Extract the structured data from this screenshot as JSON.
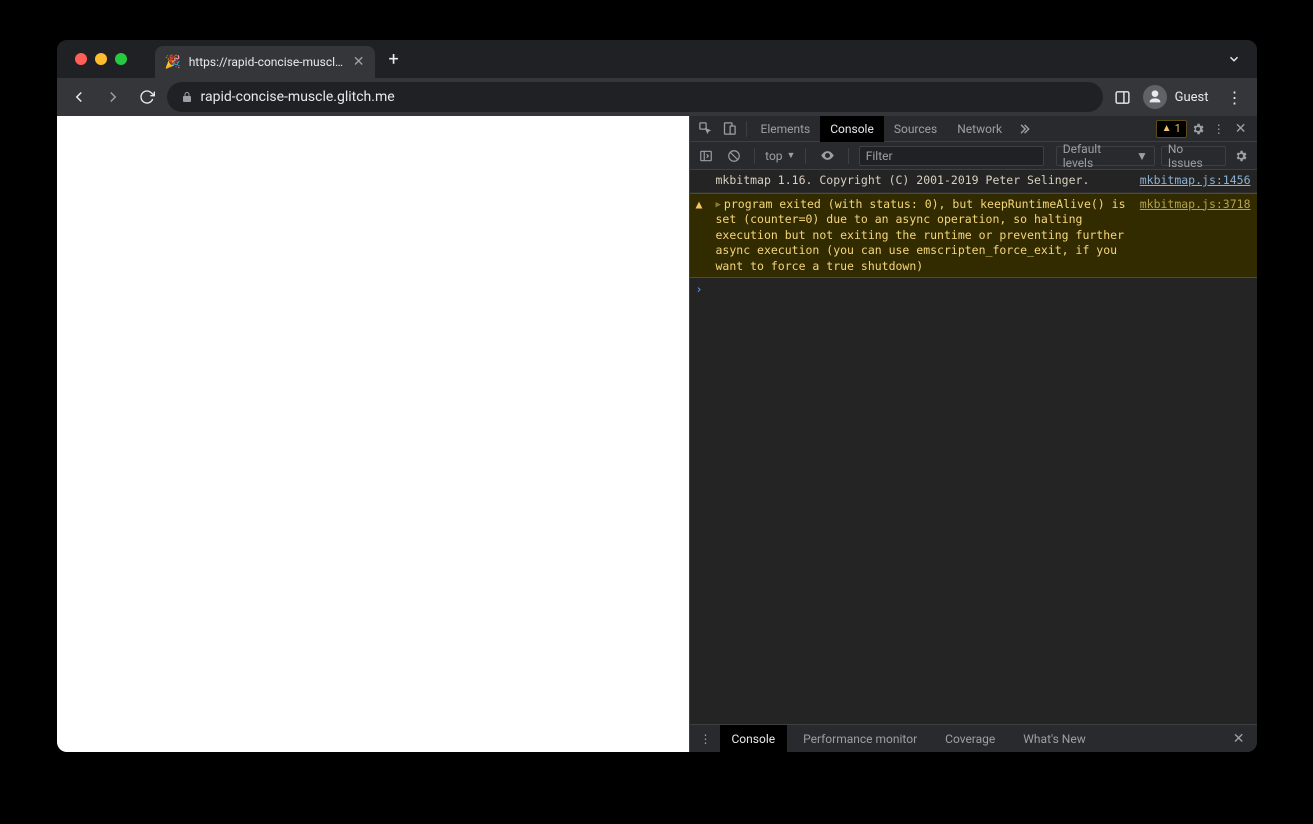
{
  "tab": {
    "favicon": "🎉",
    "title": "https://rapid-concise-muscle.g"
  },
  "url": "rapid-concise-muscle.glitch.me",
  "profile": "Guest",
  "devtools": {
    "tabs": {
      "elements": "Elements",
      "console": "Console",
      "sources": "Sources",
      "network": "Network"
    },
    "warn_count": "1"
  },
  "console_toolbar": {
    "context": "top",
    "filter_placeholder": "Filter",
    "levels": "Default levels",
    "issues": "No Issues"
  },
  "logs": {
    "info": {
      "msg": "mkbitmap 1.16. Copyright (C) 2001-2019 Peter Selinger.",
      "src": "mkbitmap.js:1456"
    },
    "warn": {
      "msg": "program exited (with status: 0), but keepRuntimeAlive() is set (counter=0) due to an async operation, so halting execution but not exiting the runtime or preventing further async execution (you can use emscripten_force_exit, if you want to force a true shutdown)",
      "src": "mkbitmap.js:3718"
    }
  },
  "drawer": {
    "console": "Console",
    "perfmon": "Performance monitor",
    "coverage": "Coverage",
    "whatsnew": "What's New"
  }
}
